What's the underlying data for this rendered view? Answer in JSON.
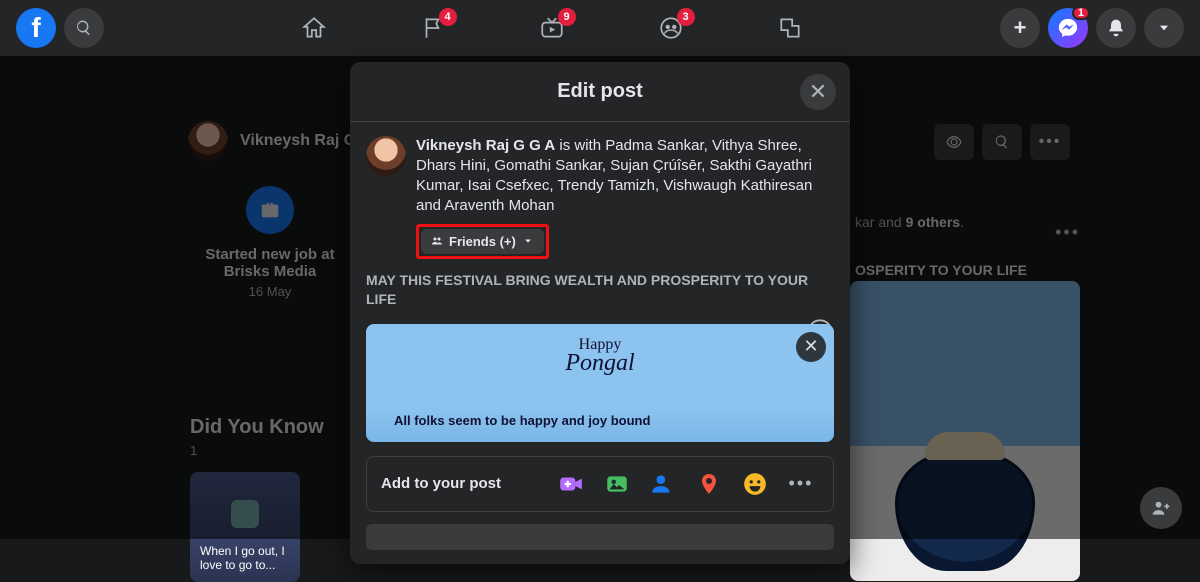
{
  "nav": {
    "watch_badge": "4",
    "video_badge": "9",
    "groups_badge": "3",
    "messenger_badge": "1"
  },
  "profile": {
    "name": "Vikneysh Raj G G"
  },
  "life_event": {
    "title": "Started new job at Brisks Media",
    "date": "16 May"
  },
  "dyk": {
    "heading": "Did You Know",
    "count": "1",
    "card_text": "When I go out, I love to go to..."
  },
  "background": {
    "with_prefix": "kar",
    "with_more": "9 others",
    "with_and": " and ",
    "prosperity": "OSPERITY TO YOUR LIFE"
  },
  "modal": {
    "title": "Edit post",
    "author": "Vikneysh Raj G G A",
    "with_text": " is with Padma Sankar, Vithya Shree, Dhars Hini, Gomathi Sankar, Sujan Çrúîsēr, Sakthi Gayathri Kumar, Isai Csefxec, Trendy Tamizh, Vishwaugh Kathiresan and Araventh Mohan",
    "audience": "Friends (+)",
    "post_body": "MAY THIS FESTIVAL BRING WEALTH AND PROSPERITY TO YOUR LIFE",
    "attach_happy": "Happy",
    "attach_pongal": "Pongal",
    "attach_line": "All folks seem to be happy and joy bound",
    "add_label": "Add to your post"
  }
}
